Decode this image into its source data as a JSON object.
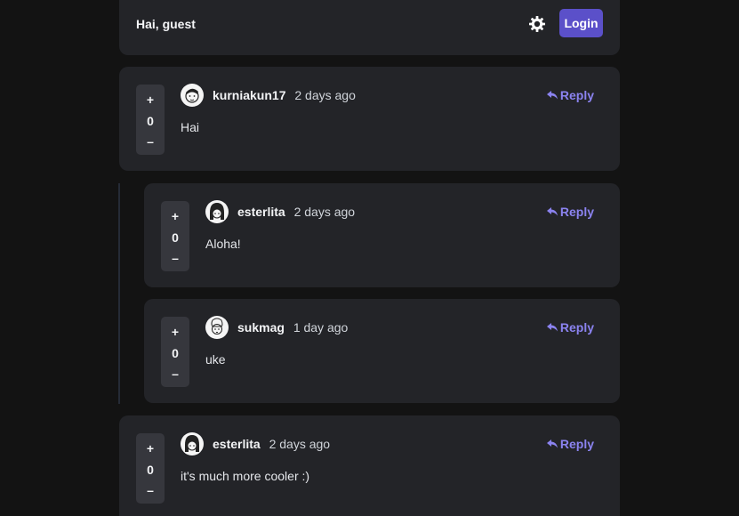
{
  "header": {
    "greeting": "Hai, guest",
    "login_label": "Login",
    "theme_icon": "sun-icon"
  },
  "comments": [
    {
      "user": "kurniakun17",
      "time": "2 days ago",
      "text": "Hai",
      "votes": "0",
      "reply_label": "Reply",
      "upvote": "+",
      "downvote": "–"
    },
    {
      "user": "esterlita",
      "time": "2 days ago",
      "text": "Aloha!",
      "votes": "0",
      "reply_label": "Reply",
      "upvote": "+",
      "downvote": "–"
    },
    {
      "user": "sukmag",
      "time": "1 day ago",
      "text": "uke",
      "votes": "0",
      "reply_label": "Reply",
      "upvote": "+",
      "downvote": "–"
    },
    {
      "user": "esterlita",
      "time": "2 days ago",
      "text": "it's much more cooler :)",
      "votes": "0",
      "reply_label": "Reply",
      "upvote": "+",
      "downvote": "–"
    }
  ],
  "colors": {
    "background": "#131313",
    "card": "#232428",
    "accent": "#5b50c9",
    "reply": "#8b83f0"
  }
}
